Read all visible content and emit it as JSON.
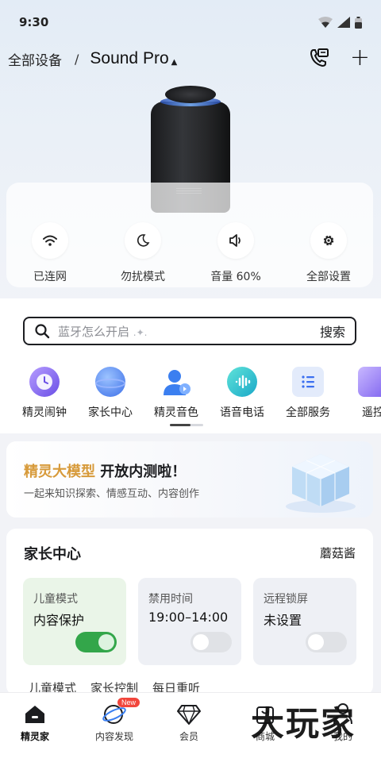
{
  "status": {
    "time": "9:30"
  },
  "nav": {
    "all_devices": "全部设备",
    "separator": "/",
    "device_name": "Sound Pro",
    "caret": "▲"
  },
  "controls": [
    {
      "label": "已连网",
      "icon": "wifi-icon"
    },
    {
      "label": "勿扰模式",
      "icon": "moon-icon"
    },
    {
      "label": "音量 60%",
      "icon": "volume-icon"
    },
    {
      "label": "全部设置",
      "icon": "gear-icon"
    }
  ],
  "search": {
    "placeholder": "蓝牙怎么开启",
    "button": "搜索"
  },
  "shortcuts": [
    {
      "label": "精灵闹钟",
      "icon": "alarm-clock-icon",
      "color": "#8a6df0"
    },
    {
      "label": "家长中心",
      "icon": "planet-icon",
      "color": "#4f86f0"
    },
    {
      "label": "精灵音色",
      "icon": "voice-avatar-icon",
      "color": "#3b7ff0"
    },
    {
      "label": "语音电话",
      "icon": "voice-call-icon",
      "color": "#20b8c8"
    },
    {
      "label": "全部服务",
      "icon": "list-icon",
      "color": "#3b6ff0"
    },
    {
      "label": "遥控",
      "icon": "remote-icon",
      "color": "#8a6df0"
    }
  ],
  "promo": {
    "highlight": "精灵大模型",
    "title_rest": "开放内测啦！",
    "subtitle": "一起来知识探索、情感互动、内容创作"
  },
  "family": {
    "title": "家长中心",
    "child_name": "蘑菇酱",
    "cards": [
      {
        "key": "儿童模式",
        "value": "内容保护",
        "toggle_on": true
      },
      {
        "key": "禁用时间",
        "value": "19:00–14:00",
        "toggle_on": false
      },
      {
        "key": "远程锁屏",
        "value": "未设置",
        "toggle_on": false
      }
    ],
    "strip": [
      "儿童模式",
      "家长控制",
      "每日重听"
    ]
  },
  "tabs": [
    {
      "label": "精灵家",
      "icon": "home-icon",
      "active": true
    },
    {
      "label": "内容发现",
      "icon": "discover-icon",
      "badge": "New"
    },
    {
      "label": "会员",
      "icon": "diamond-icon"
    },
    {
      "label": "商城",
      "icon": "shop-icon"
    },
    {
      "label": "我的",
      "icon": "profile-icon"
    }
  ],
  "watermark": "大玩家",
  "colors": {
    "accent_gold": "#d79a3a",
    "toggle_on": "#33a64a",
    "badge": "#f2463c"
  }
}
